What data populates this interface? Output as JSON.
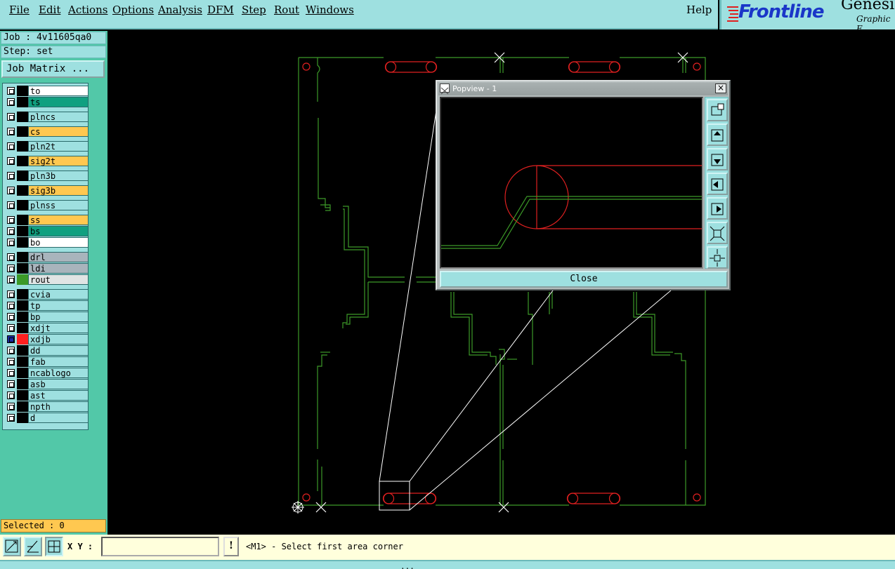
{
  "menu": [
    "File",
    "Edit",
    "Actions",
    "Options",
    "Analysis",
    "DFM",
    "Step",
    "Rout",
    "Windows"
  ],
  "help": "Help",
  "logo": {
    "brand": "Frontline",
    "product": "Genesis",
    "tagline": "Graphic E"
  },
  "job": "Job : 4v11605qa0",
  "step": "Step: set",
  "job_matrix": "Job Matrix ...",
  "layers": [
    {
      "name": "to",
      "color": "#000000",
      "bg": "#ffffff"
    },
    {
      "name": "ts",
      "color": "#000000",
      "bg": "#10a080"
    },
    {
      "name": "plncs",
      "color": "#000000",
      "bg": "#9ee0e0"
    },
    {
      "name": "cs",
      "color": "#000000",
      "bg": "#ffc850"
    },
    {
      "name": "pln2t",
      "color": "#000000",
      "bg": "#9ee0e0"
    },
    {
      "name": "sig2t",
      "color": "#000000",
      "bg": "#ffc850"
    },
    {
      "name": "pln3b",
      "color": "#000000",
      "bg": "#9ee0e0"
    },
    {
      "name": "sig3b",
      "color": "#000000",
      "bg": "#ffc850"
    },
    {
      "name": "plnss",
      "color": "#000000",
      "bg": "#9ee0e0"
    },
    {
      "name": "ss",
      "color": "#000000",
      "bg": "#ffc850"
    },
    {
      "name": "bs",
      "color": "#000000",
      "bg": "#10a080"
    },
    {
      "name": "bo",
      "color": "#000000",
      "bg": "#ffffff"
    },
    {
      "name": "drl",
      "color": "#000000",
      "bg": "#a8b4bc"
    },
    {
      "name": "ldi",
      "color": "#000000",
      "bg": "#a8b4bc"
    },
    {
      "name": "rout",
      "color": "#3c9a28",
      "bg": "#e0e4e4"
    },
    {
      "name": "cvia",
      "color": "#000000",
      "bg": "#9ee0e0"
    },
    {
      "name": "tp",
      "color": "#000000",
      "bg": "#9ee0e0"
    },
    {
      "name": "bp",
      "color": "#000000",
      "bg": "#9ee0e0"
    },
    {
      "name": "xdjt",
      "color": "#000000",
      "bg": "#9ee0e0"
    },
    {
      "name": "xdjb",
      "color": "#ff2020",
      "bg": "#9ee0e0"
    },
    {
      "name": "dd",
      "color": "#000000",
      "bg": "#9ee0e0"
    },
    {
      "name": "fab",
      "color": "#000000",
      "bg": "#9ee0e0"
    },
    {
      "name": "ncablogo",
      "color": "#000000",
      "bg": "#9ee0e0"
    },
    {
      "name": "asb",
      "color": "#000000",
      "bg": "#9ee0e0"
    },
    {
      "name": "ast",
      "color": "#000000",
      "bg": "#9ee0e0"
    },
    {
      "name": "npth",
      "color": "#000000",
      "bg": "#9ee0e0"
    },
    {
      "name": "d",
      "color": "#000000",
      "bg": "#9ee0e0"
    }
  ],
  "selected": "Selected : 0",
  "xy_label": "X Y :",
  "xy_value": "",
  "prompt": "<M1> - Select first area corner",
  "status": "...",
  "popview": {
    "title": "Popview - 1",
    "close": "Close"
  },
  "colors": {
    "outline": "#3c9a28",
    "pad": "#e02020",
    "panel": "#9ee0e0",
    "background": "#000000"
  }
}
